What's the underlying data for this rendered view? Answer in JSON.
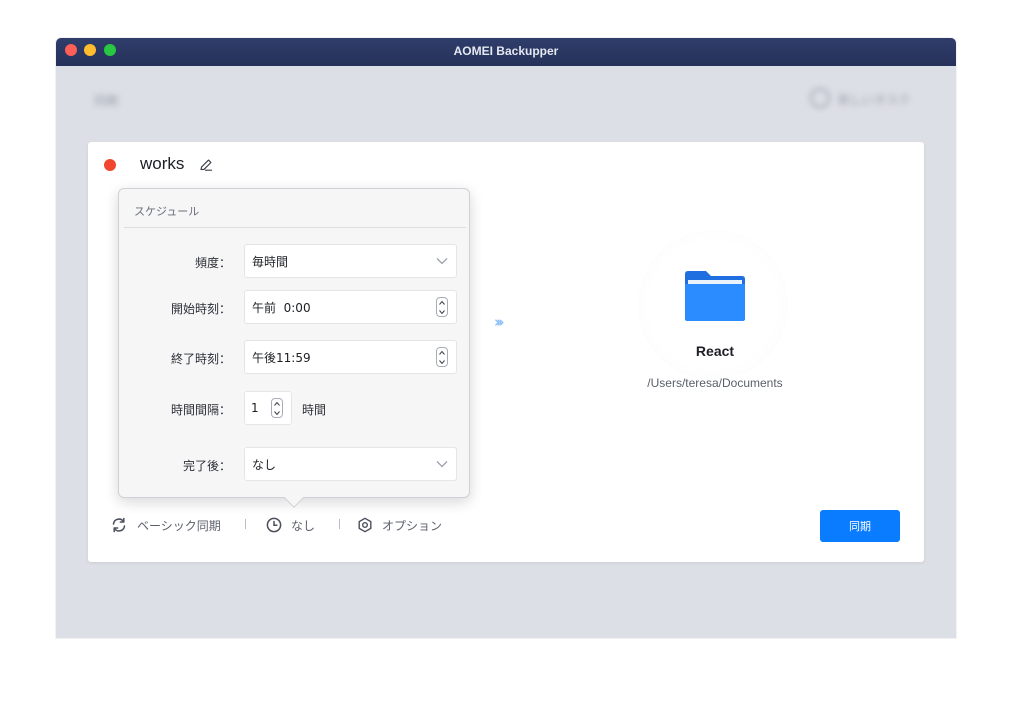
{
  "window": {
    "title": "AOMEI Backupper"
  },
  "blurred": {
    "top_left": "同期",
    "top_right": "新しいタスク"
  },
  "task": {
    "name": "works",
    "status_color": "#f0452f"
  },
  "destination": {
    "name": "React",
    "path": "/Users/teresa/Documents",
    "icon": "folder-icon"
  },
  "bottom_bar": {
    "mode_label": "ベーシック同期",
    "schedule_label": "なし",
    "options_label": "オプション"
  },
  "sync_button": {
    "label": "同期",
    "color": "#0a7cff"
  },
  "schedule_popover": {
    "title": "スケジュール",
    "frequency_label": "頻度：",
    "frequency_value": "毎時間",
    "start_label": "開始時刻：",
    "start_value": "午前  0:00",
    "end_label": "終了時刻：",
    "end_value": "午後11:59",
    "interval_label": "時間間隔：",
    "interval_value": "1",
    "interval_unit": "時間",
    "after_label": "完了後：",
    "after_value": "なし"
  }
}
